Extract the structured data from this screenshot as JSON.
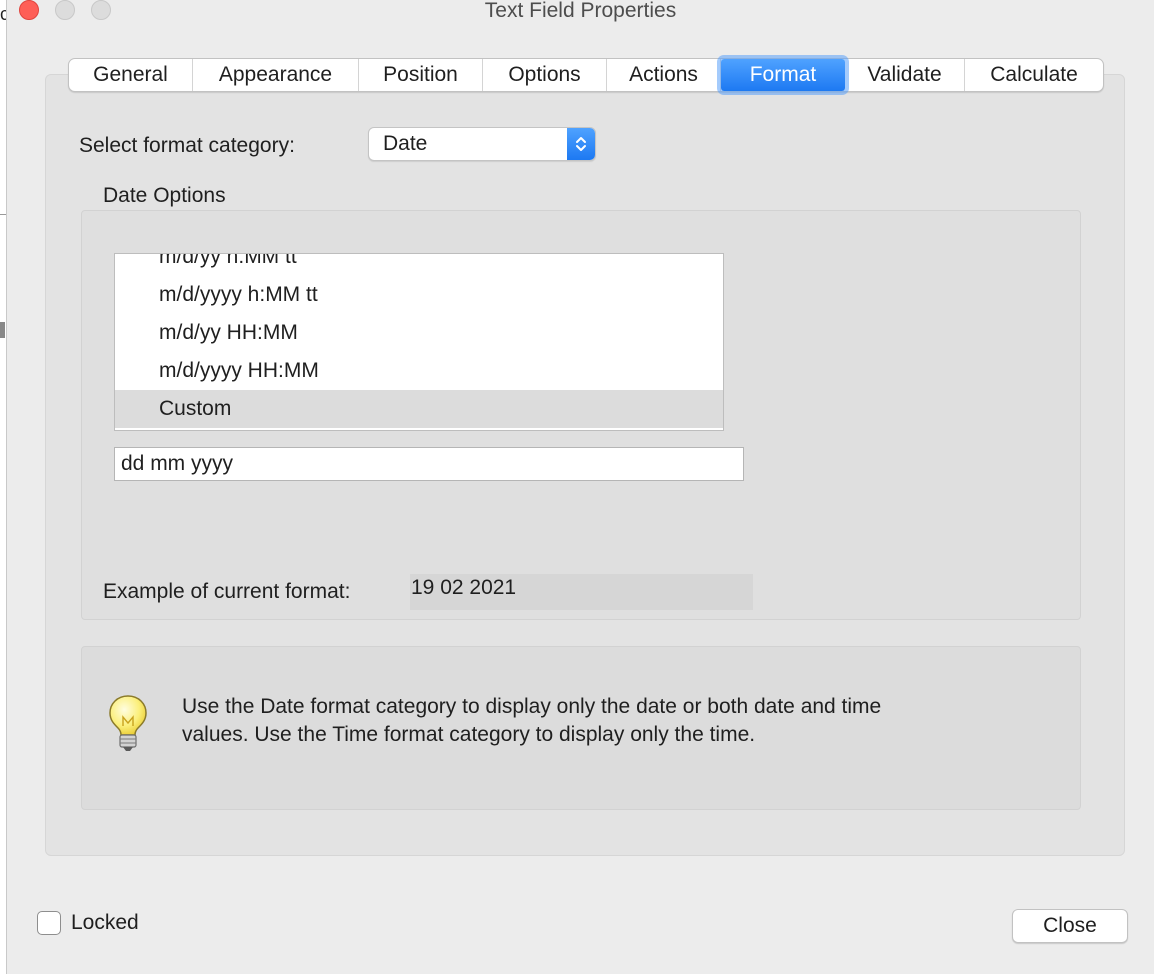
{
  "window": {
    "title": "Text Field Properties"
  },
  "edge": {
    "glyph": "c"
  },
  "tabs": [
    {
      "label": "General",
      "active": false
    },
    {
      "label": "Appearance",
      "active": false
    },
    {
      "label": "Position",
      "active": false
    },
    {
      "label": "Options",
      "active": false
    },
    {
      "label": "Actions",
      "active": false
    },
    {
      "label": "Format",
      "active": true
    },
    {
      "label": "Validate",
      "active": false
    },
    {
      "label": "Calculate",
      "active": false
    }
  ],
  "format": {
    "category_label": "Select format category:",
    "category_value": "Date"
  },
  "date_options": {
    "group_label": "Date Options",
    "list_items": [
      {
        "label": "m/d/yy h:MM tt",
        "selected": false
      },
      {
        "label": "m/d/yyyy h:MM tt",
        "selected": false
      },
      {
        "label": "m/d/yy HH:MM",
        "selected": false
      },
      {
        "label": "m/d/yyyy HH:MM",
        "selected": false
      },
      {
        "label": "Custom",
        "selected": true
      }
    ],
    "custom_value": "dd mm yyyy",
    "example_label": "Example of current format:",
    "example_value": "19 02 2021"
  },
  "info": {
    "icon": "lightbulb-icon",
    "text_line1": "Use the Date format category to display only the date or both date and time",
    "text_line2": "values. Use the Time format category to display only the time."
  },
  "footer": {
    "locked_label": "Locked",
    "locked_checked": false,
    "close_label": "Close"
  },
  "colors": {
    "accent": "#1d79f2",
    "close_light": "#fe5f57",
    "window_bg": "#ececec"
  }
}
